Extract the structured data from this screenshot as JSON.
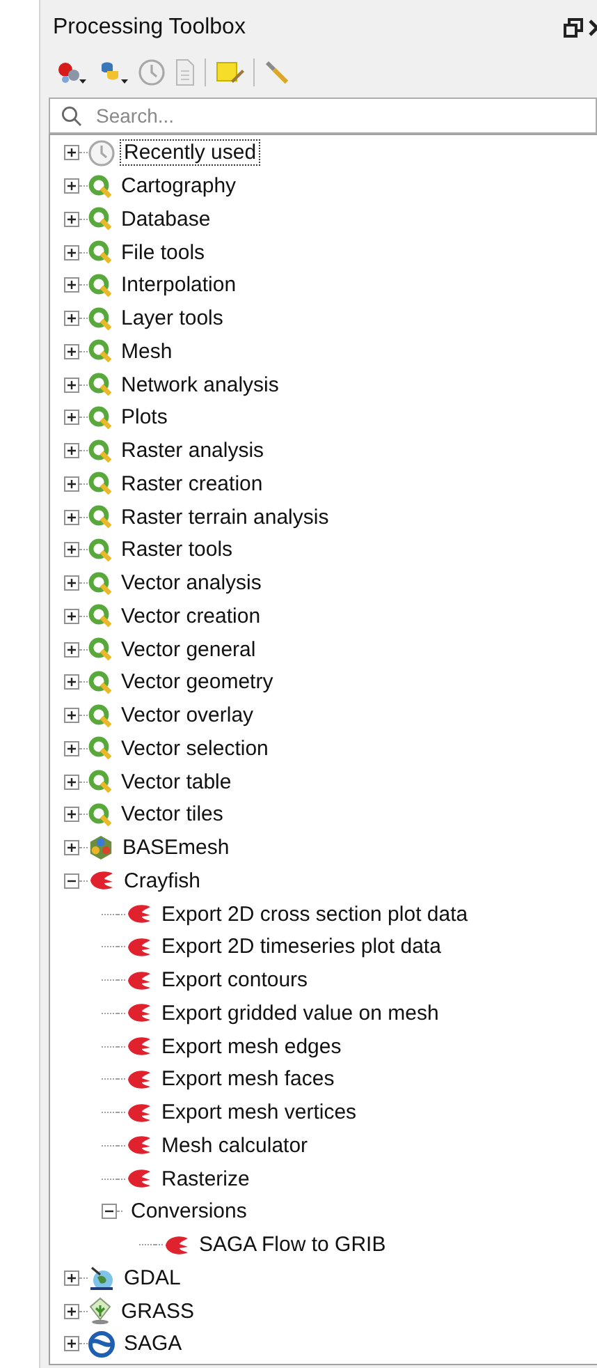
{
  "panel": {
    "title": "Processing Toolbox"
  },
  "search": {
    "placeholder": "Search..."
  },
  "tree": [
    {
      "label": "Recently used",
      "kind": "history",
      "expanded": false,
      "focused": true
    },
    {
      "label": "Cartography",
      "kind": "qgis",
      "expanded": false,
      "focused": false
    },
    {
      "label": "Database",
      "kind": "qgis",
      "expanded": false,
      "focused": false
    },
    {
      "label": "File tools",
      "kind": "qgis",
      "expanded": false,
      "focused": false
    },
    {
      "label": "Interpolation",
      "kind": "qgis",
      "expanded": false,
      "focused": false
    },
    {
      "label": "Layer tools",
      "kind": "qgis",
      "expanded": false,
      "focused": false
    },
    {
      "label": "Mesh",
      "kind": "qgis",
      "expanded": false,
      "focused": false
    },
    {
      "label": "Network analysis",
      "kind": "qgis",
      "expanded": false,
      "focused": false
    },
    {
      "label": "Plots",
      "kind": "qgis",
      "expanded": false,
      "focused": false
    },
    {
      "label": "Raster analysis",
      "kind": "qgis",
      "expanded": false,
      "focused": false
    },
    {
      "label": "Raster creation",
      "kind": "qgis",
      "expanded": false,
      "focused": false
    },
    {
      "label": "Raster terrain analysis",
      "kind": "qgis",
      "expanded": false,
      "focused": false
    },
    {
      "label": "Raster tools",
      "kind": "qgis",
      "expanded": false,
      "focused": false
    },
    {
      "label": "Vector analysis",
      "kind": "qgis",
      "expanded": false,
      "focused": false
    },
    {
      "label": "Vector creation",
      "kind": "qgis",
      "expanded": false,
      "focused": false
    },
    {
      "label": "Vector general",
      "kind": "qgis",
      "expanded": false,
      "focused": false
    },
    {
      "label": "Vector geometry",
      "kind": "qgis",
      "expanded": false,
      "focused": false
    },
    {
      "label": "Vector overlay",
      "kind": "qgis",
      "expanded": false,
      "focused": false
    },
    {
      "label": "Vector selection",
      "kind": "qgis",
      "expanded": false,
      "focused": false
    },
    {
      "label": "Vector table",
      "kind": "qgis",
      "expanded": false,
      "focused": false
    },
    {
      "label": "Vector tiles",
      "kind": "qgis",
      "expanded": false,
      "focused": false
    },
    {
      "label": "BASEmesh",
      "kind": "basemesh",
      "expanded": false,
      "focused": false
    },
    {
      "label": "Crayfish",
      "kind": "crayfish",
      "expanded": true,
      "focused": false,
      "children": [
        {
          "label": "Export 2D cross section plot data",
          "kind": "crayfish",
          "focused": false
        },
        {
          "label": "Export 2D timeseries plot data",
          "kind": "crayfish",
          "focused": false
        },
        {
          "label": "Export contours",
          "kind": "crayfish",
          "focused": false
        },
        {
          "label": "Export gridded value on mesh",
          "kind": "crayfish",
          "focused": false
        },
        {
          "label": "Export mesh edges",
          "kind": "crayfish",
          "focused": false
        },
        {
          "label": "Export mesh faces",
          "kind": "crayfish",
          "focused": false
        },
        {
          "label": "Export mesh vertices",
          "kind": "crayfish",
          "focused": false
        },
        {
          "label": "Mesh calculator",
          "kind": "crayfish",
          "focused": false
        },
        {
          "label": "Rasterize",
          "kind": "crayfish",
          "focused": false
        },
        {
          "label": "Conversions",
          "kind": "folder",
          "expanded": true,
          "focused": false,
          "children": [
            {
              "label": "SAGA Flow to GRIB",
              "kind": "crayfish",
              "focused": false
            }
          ]
        }
      ]
    },
    {
      "label": "GDAL",
      "kind": "gdal",
      "expanded": false,
      "focused": false
    },
    {
      "label": "GRASS",
      "kind": "grass",
      "expanded": false,
      "focused": false
    },
    {
      "label": "SAGA",
      "kind": "saga",
      "expanded": false,
      "focused": false
    }
  ]
}
